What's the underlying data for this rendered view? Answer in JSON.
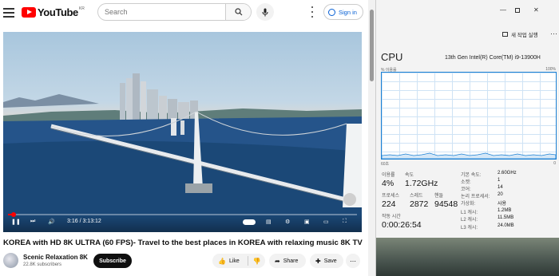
{
  "youtube": {
    "logo_text": "YouTube",
    "logo_region": "KR",
    "search_placeholder": "Search",
    "sign_in_label": "Sign in",
    "video": {
      "title": "KOREA with HD 8K ULTRA (60 FPS)- Travel to the best places in KOREA with relaxing music 8K TV",
      "time_current": "3:16",
      "time_total": "3:13:12",
      "progress_fraction": 0.017
    },
    "channel": {
      "name": "Scenic Relaxation 8K",
      "subscribers": "22.8K subscribers",
      "subscribe_label": "Subscribe"
    },
    "actions": {
      "like_label": "Like",
      "share_label": "Share",
      "save_label": "Save"
    }
  },
  "task_manager": {
    "new_task_label": "새 작업 실행",
    "cpu_heading": "CPU",
    "cpu_name": "13th Gen Intel(R) Core(TM) i9-13900H",
    "utilization_label": "% 이용률",
    "max_pct": "100%",
    "graph_seconds": "60초",
    "graph_zero": "0",
    "stats": {
      "utilization_label": "이용률",
      "utilization_value": "4%",
      "speed_label": "속도",
      "speed_value": "1.72GHz",
      "processes_label": "프로세스",
      "processes_value": "224",
      "threads_label": "스레드",
      "threads_value": "2872",
      "handles_label": "핸들",
      "handles_value": "94548",
      "uptime_label": "작동 시간",
      "uptime_value": "0:00:26:54"
    },
    "specs": [
      {
        "label": "기본 속도:",
        "value": "2.60GHz"
      },
      {
        "label": "소켓:",
        "value": "1"
      },
      {
        "label": "코어:",
        "value": "14"
      },
      {
        "label": "논리 프로세서:",
        "value": "20"
      },
      {
        "label": "가상화:",
        "value": "사용"
      },
      {
        "label": "L1 캐시:",
        "value": "1.2MB"
      },
      {
        "label": "L2 캐시:",
        "value": "11.5MB"
      },
      {
        "label": "L3 캐시:",
        "value": "24.0MB"
      }
    ]
  }
}
